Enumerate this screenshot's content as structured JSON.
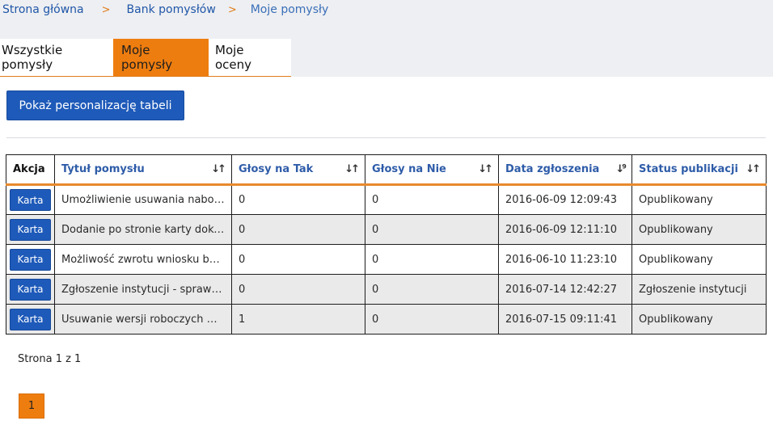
{
  "breadcrumb": {
    "items": [
      "Strona główna",
      "Bank pomysłów",
      "Moje pomysły"
    ],
    "separator": ">"
  },
  "tabs": [
    {
      "label": "Wszystkie pomysły",
      "active": false
    },
    {
      "label": "Moje pomysły",
      "active": true
    },
    {
      "label": "Moje oceny",
      "active": false
    }
  ],
  "personalize_button": "Pokaż personalizację tabeli",
  "table": {
    "columns": [
      "Akcja",
      "Tytuł pomysłu",
      "Głosy na Tak",
      "Głosy na Nie",
      "Data zgłoszenia",
      "Status publikacji"
    ],
    "sort_icons": [
      "sort-icon",
      "sort-icon",
      "sort-icon",
      "sort-descending-icon",
      "sort-icon"
    ],
    "rows": [
      {
        "action": "Karta",
        "title": "Umożliwienie usuwania naborów …",
        "yes": "0",
        "no": "0",
        "date": "2016-06-09 12:09:43",
        "status": "Opublikowany"
      },
      {
        "action": "Karta",
        "title": "Dodanie po stronie karty doku…",
        "yes": "0",
        "no": "0",
        "date": "2016-06-09 12:11:10",
        "status": "Opublikowany"
      },
      {
        "action": "Karta",
        "title": "Możliwość zwrotu wniosku bez z…",
        "yes": "0",
        "no": "0",
        "date": "2016-06-10 11:23:10",
        "status": "Opublikowany"
      },
      {
        "action": "Karta",
        "title": "Zgłoszenie instytucji - sprawdza…",
        "yes": "0",
        "no": "0",
        "date": "2016-07-14 12:42:27",
        "status": "Zgłoszenie instytucji"
      },
      {
        "action": "Karta",
        "title": "Usuwanie wersji roboczych wnio…",
        "yes": "1",
        "no": "0",
        "date": "2016-07-15 09:11:41",
        "status": "Opublikowany"
      }
    ]
  },
  "pagination": {
    "info": "Strona 1 z 1",
    "current_page": "1"
  },
  "colors": {
    "accent_orange": "#ee7d0f",
    "primary_blue": "#1e5ab9",
    "link_blue": "#2e5ca8"
  }
}
